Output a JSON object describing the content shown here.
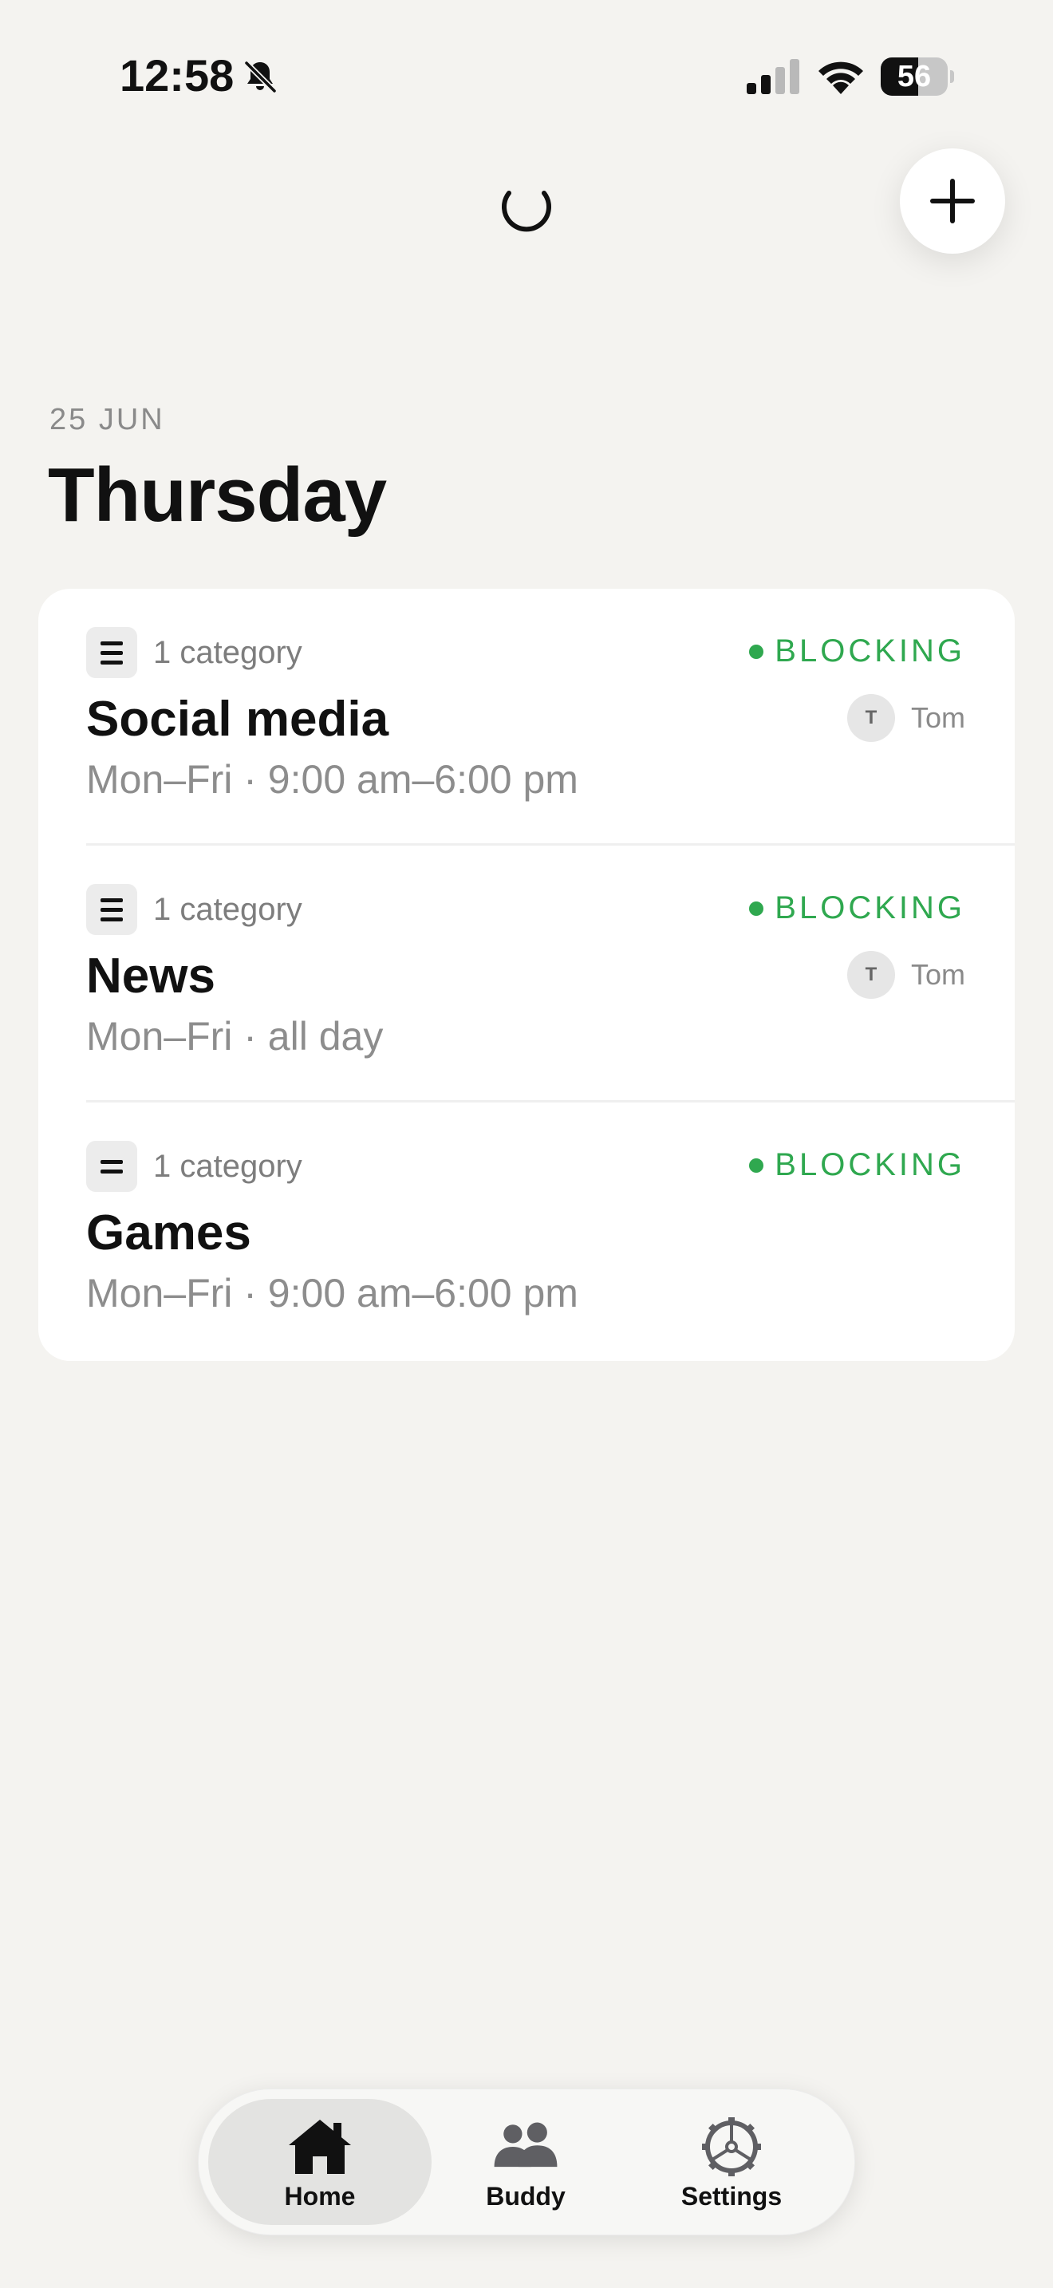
{
  "status_bar": {
    "time": "12:58",
    "battery_percent": 56,
    "battery_text": "56"
  },
  "header": {
    "add_button_icon": "plus-icon",
    "loading_icon": "spinner-icon"
  },
  "date": {
    "small": "25 JUN",
    "day": "Thursday"
  },
  "colors": {
    "accent_green": "#2fa84f",
    "background": "#f4f3f0"
  },
  "blocks": [
    {
      "category_count": "1 category",
      "status": "BLOCKING",
      "title": "Social media",
      "schedule": "Mon–Fri · 9:00 am–6:00 pm",
      "buddy_initial": "T",
      "buddy_name": "Tom"
    },
    {
      "category_count": "1 category",
      "status": "BLOCKING",
      "title": "News",
      "schedule": "Mon–Fri · all day",
      "buddy_initial": "T",
      "buddy_name": "Tom"
    },
    {
      "category_count": "1 category",
      "status": "BLOCKING",
      "title": "Games",
      "schedule": "Mon–Fri · 9:00 am–6:00 pm"
    }
  ],
  "tabs": [
    {
      "label": "Home",
      "icon": "home-icon",
      "active": true
    },
    {
      "label": "Buddy",
      "icon": "buddy-icon",
      "active": false
    },
    {
      "label": "Settings",
      "icon": "gear-icon",
      "active": false
    }
  ]
}
